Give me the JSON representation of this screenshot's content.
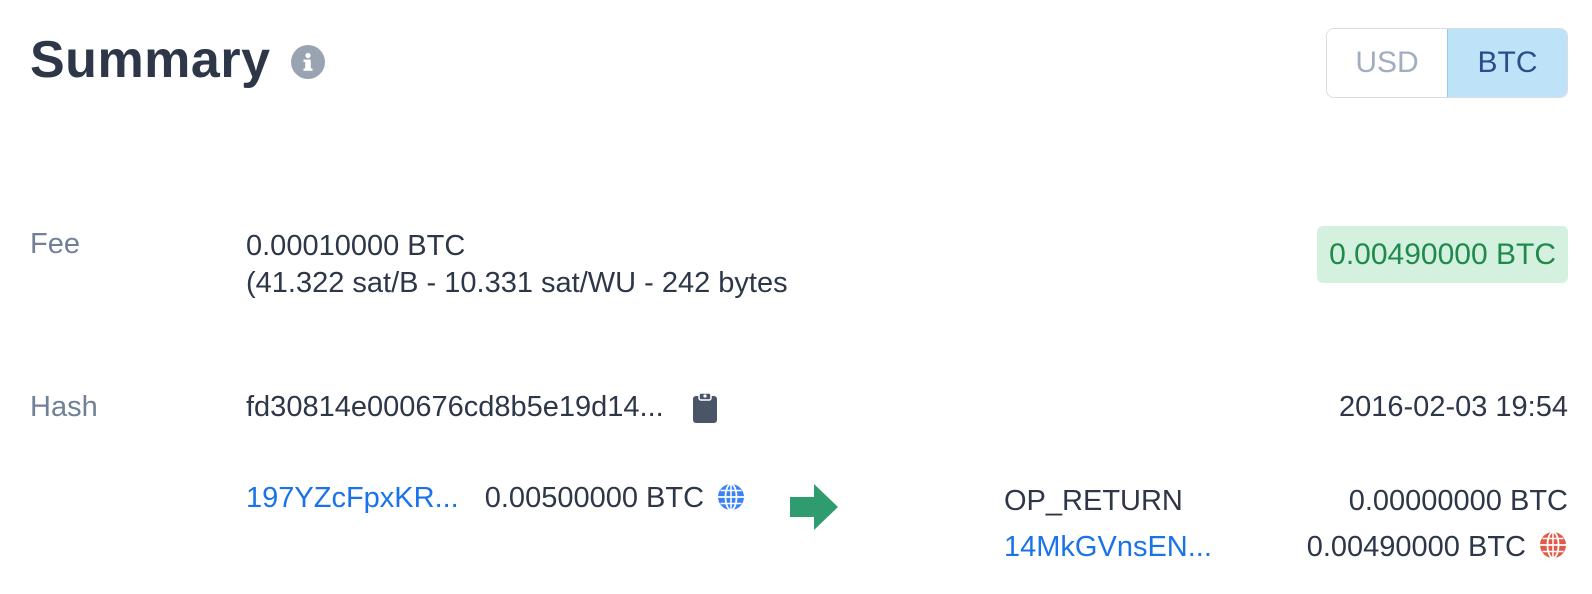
{
  "header": {
    "title": "Summary",
    "info_icon": "info-icon"
  },
  "currency_toggle": {
    "options": [
      "USD",
      "BTC"
    ],
    "selected": "BTC"
  },
  "fee": {
    "label": "Fee",
    "amount": "0.00010000 BTC",
    "detail": "(41.322 sat/B - 10.331 sat/WU - 242 bytes)"
  },
  "total": {
    "amount": "0.00490000 BTC",
    "color": "#1f8a4c",
    "background": "#d4f1df"
  },
  "hash": {
    "label": "Hash",
    "value": "fd30814e000676cd8b5e19d14...",
    "copy_icon": "clipboard-icon"
  },
  "timestamp": "2016-02-03 19:54",
  "inputs": [
    {
      "address": "197YZcFpxKR...",
      "amount": "0.00500000 BTC",
      "icon": "globe-icon",
      "icon_color": "#3b82f6"
    }
  ],
  "arrow": {
    "icon": "arrow-right-icon",
    "color": "#2e9c6f"
  },
  "outputs": [
    {
      "label": "OP_RETURN",
      "amount": "0.00000000 BTC"
    },
    {
      "address": "14MkGVnsEN...",
      "amount": "0.00490000 BTC",
      "icon": "globe-icon",
      "icon_color": "#e05a47"
    }
  ]
}
